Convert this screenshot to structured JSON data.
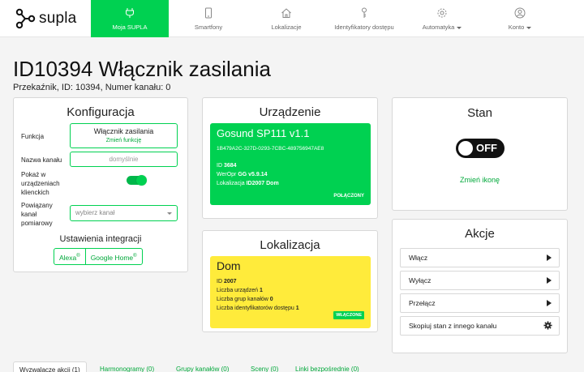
{
  "brand": {
    "name": "supla"
  },
  "nav": [
    {
      "label": "Moja SUPLA",
      "icon": "plug-icon",
      "active": true
    },
    {
      "label": "Smartfony",
      "icon": "smartphone-icon",
      "active": false
    },
    {
      "label": "Lokalizacje",
      "icon": "home-icon",
      "active": false
    },
    {
      "label": "Identyfikatory dostępu",
      "icon": "key-icon",
      "active": false
    },
    {
      "label": "Automatyka",
      "icon": "gear-icon",
      "active": false,
      "dropdown": true
    },
    {
      "label": "Konto",
      "icon": "user-icon",
      "active": false,
      "dropdown": true
    }
  ],
  "page": {
    "title": "ID10394 Włącznik zasilania",
    "subtitle": "Przekaźnik, ID: 10394, Numer kanału: 0"
  },
  "config": {
    "title": "Konfiguracja",
    "function_label": "Funkcja",
    "function_value": "Włącznik zasilania",
    "function_change": "Zmień funkcję",
    "channel_name_label": "Nazwa kanału",
    "channel_name_placeholder": "domyślnie",
    "show_in_clients_label_1": "Pokaż w",
    "show_in_clients_label_2": "urządzeniach",
    "show_in_clients_label_3": "klienckich",
    "show_in_clients": true,
    "linked_channel_label_1": "Powiązany",
    "linked_channel_label_2": "kanał",
    "linked_channel_label_3": "pomiarowy",
    "linked_channel_placeholder": "wybierz kanał",
    "integrations_title": "Ustawienia integracji",
    "integration_alexa": "Alexa",
    "integration_google": "Google Home",
    "registered_mark": "®"
  },
  "device": {
    "title": "Urządzenie",
    "name": "Gosund SP111 v1.1",
    "guid": "1B479A2C-327D-0293-7CBC-489756947AE8",
    "id_label": "ID",
    "id": "3684",
    "soft_label": "WerOpr",
    "soft": "GG v5.9.14",
    "location_label": "Lokalizacja",
    "location": "ID2007 Dom",
    "status": "POŁĄCZONY",
    "color": "#00d151"
  },
  "location": {
    "title": "Lokalizacja",
    "name": "Dom",
    "id_label": "ID",
    "id": "2007",
    "devices_label": "Liczba urządzeń",
    "devices": "1",
    "groups_label": "Liczba grup kanałów",
    "groups": "0",
    "aids_label": "Liczba identyfikatorów dostępu",
    "aids": "1",
    "badge": "WŁĄCZONE",
    "color": "#ffeb3b"
  },
  "state": {
    "title": "Stan",
    "value": "OFF",
    "change_icon": "Zmień ikonę"
  },
  "actions": {
    "title": "Akcje",
    "items": [
      {
        "label": "Włącz",
        "icon": "play-icon"
      },
      {
        "label": "Wyłącz",
        "icon": "play-icon"
      },
      {
        "label": "Przełącz",
        "icon": "play-icon"
      },
      {
        "label": "Skopiuj stan z innego kanału",
        "icon": "gear-icon"
      }
    ]
  },
  "bottom_tabs": [
    {
      "label": "Wyzwalacze akcji (1)",
      "active": true
    },
    {
      "label": "Harmonogramy (0)",
      "active": false
    },
    {
      "label": "Grupy kanałów (0)",
      "active": false
    },
    {
      "label": "Sceny (0)",
      "active": false
    },
    {
      "label": "Linki bezpośrednie (0)",
      "active": false
    }
  ]
}
